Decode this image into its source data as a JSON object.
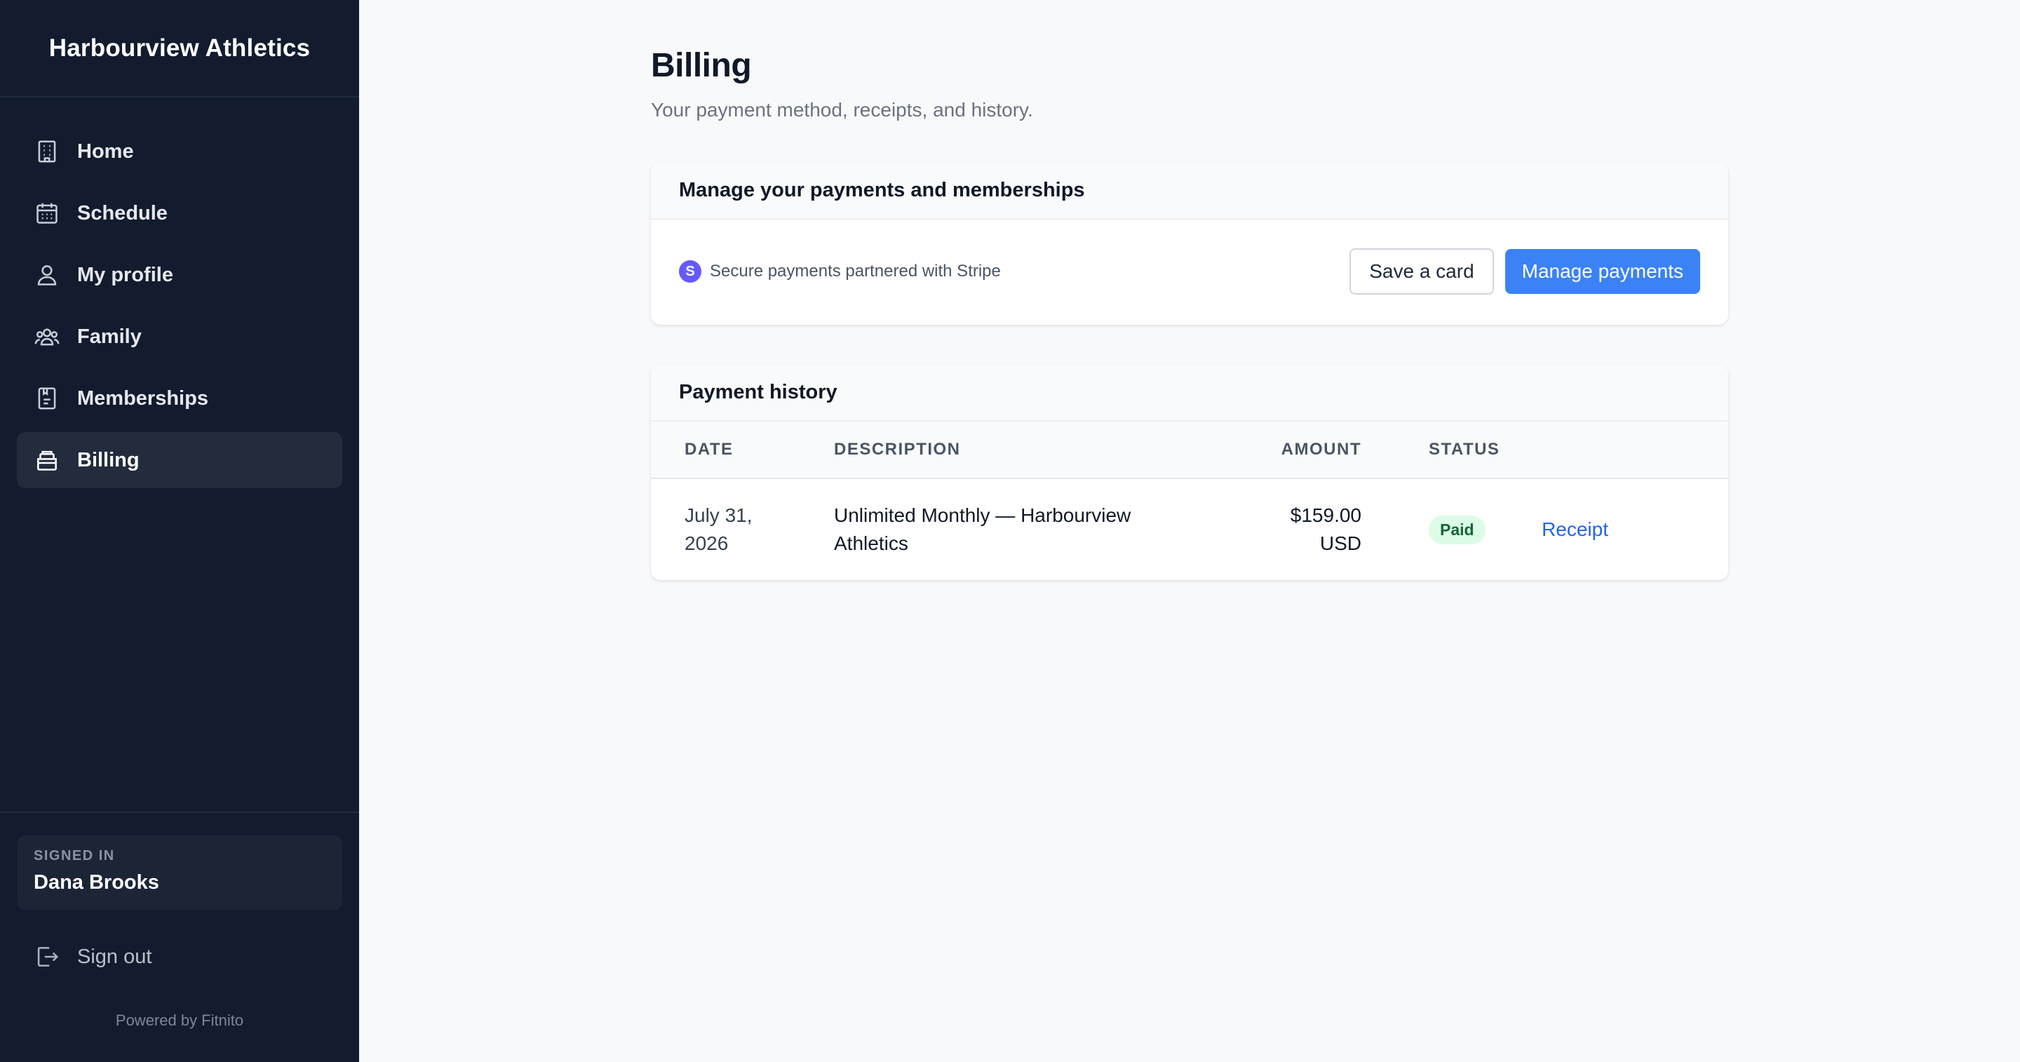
{
  "sidebar": {
    "brand": "Harbourview Athletics",
    "items": [
      {
        "label": "Home",
        "icon": "building-icon"
      },
      {
        "label": "Schedule",
        "icon": "calendar-icon"
      },
      {
        "label": "My profile",
        "icon": "user-icon"
      },
      {
        "label": "Family",
        "icon": "users-icon"
      },
      {
        "label": "Memberships",
        "icon": "clipboard-icon"
      },
      {
        "label": "Billing",
        "icon": "wallet-icon",
        "active": true
      }
    ],
    "signed_in_label": "SIGNED IN",
    "user_name": "Dana Brooks",
    "sign_out_label": "Sign out",
    "powered_by": "Powered by Fitnito"
  },
  "page": {
    "title": "Billing",
    "subtitle": "Your payment method, receipts, and history."
  },
  "payments_card": {
    "title": "Manage your payments and memberships",
    "stripe_badge": "S",
    "stripe_text": "Secure payments partnered with Stripe",
    "save_card_label": "Save a card",
    "manage_payments_label": "Manage payments"
  },
  "history_card": {
    "title": "Payment history",
    "columns": [
      "DATE",
      "DESCRIPTION",
      "AMOUNT",
      "STATUS"
    ],
    "rows": [
      {
        "date_line1": "July 31,",
        "date_line2": "2026",
        "desc_line1": "Unlimited Monthly — Harbourview",
        "desc_line2": "Athletics",
        "amount_line1": "$159.00",
        "amount_line2": "USD",
        "status": "Paid",
        "action": "Receipt"
      }
    ]
  },
  "colors": {
    "sidebar_bg": "#131c2e",
    "accent": "#3b82f6",
    "link": "#2563eb",
    "paid_badge_bg": "#dcfce7",
    "paid_badge_text": "#166534",
    "stripe": "#635bff"
  }
}
